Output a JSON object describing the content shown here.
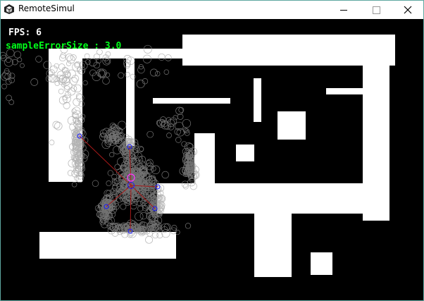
{
  "window": {
    "title": "RemoteSimul",
    "icons": {
      "app": "unity-logo-icon",
      "minimize": "minimize-icon",
      "maximize": "maximize-icon",
      "close": "close-icon"
    }
  },
  "overlay": {
    "fps_text": "FPS: 6",
    "sample_error_text": "sampleErrorSize : 3.0"
  },
  "colors": {
    "background": "#000000",
    "walls": "#ffffff",
    "particles": "#9a9a9a",
    "sensors": "#1a1aff",
    "estimate": "#ff33ff",
    "rays": "#aa1a1a",
    "fps_text": "#ffffff",
    "error_text": "#00ff1a"
  }
}
